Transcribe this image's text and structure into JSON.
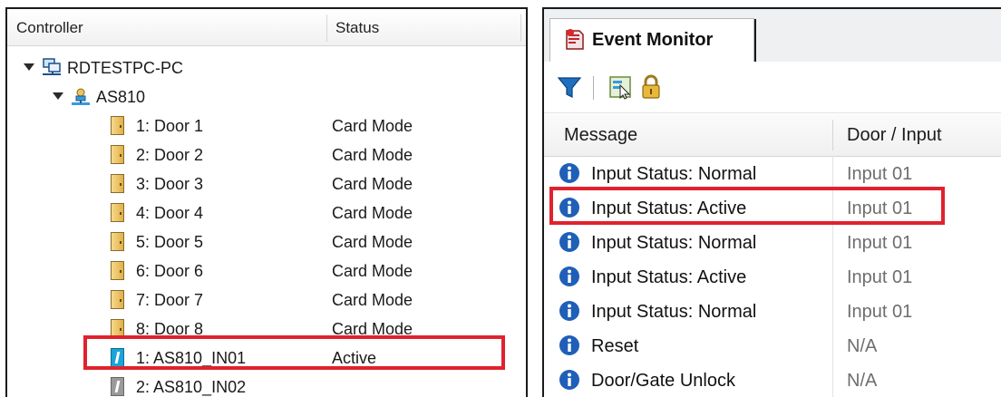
{
  "controller_panel": {
    "header": {
      "controller_col": "Controller",
      "status_col": "Status"
    },
    "pc": {
      "label": "RDTESTPC-PC"
    },
    "controller": {
      "label": "AS810"
    },
    "doors": [
      {
        "label": "1: Door 1",
        "status": "Card Mode"
      },
      {
        "label": "2: Door 2",
        "status": "Card Mode"
      },
      {
        "label": "3: Door 3",
        "status": "Card Mode"
      },
      {
        "label": "4: Door 4",
        "status": "Card Mode"
      },
      {
        "label": "5: Door 5",
        "status": "Card Mode"
      },
      {
        "label": "6: Door 6",
        "status": "Card Mode"
      },
      {
        "label": "7: Door 7",
        "status": "Card Mode"
      },
      {
        "label": "8: Door 8",
        "status": "Card Mode"
      }
    ],
    "inputs": [
      {
        "label": "1: AS810_IN01",
        "status": "Active",
        "icon": "input-active-icon"
      },
      {
        "label": "2: AS810_IN02",
        "status": "",
        "icon": "input-inactive-icon"
      }
    ]
  },
  "event_monitor": {
    "tab_label": "Event Monitor",
    "toolbar": {
      "icons": [
        "filter-icon",
        "select-icon",
        "lock-icon"
      ]
    },
    "header": {
      "message_col": "Message",
      "door_col": "Door / Input"
    },
    "rows": [
      {
        "message": "Input Status: Normal",
        "door": "Input 01"
      },
      {
        "message": "Input Status: Active",
        "door": "Input 01"
      },
      {
        "message": "Input Status: Normal",
        "door": "Input 01"
      },
      {
        "message": "Input Status: Active",
        "door": "Input 01"
      },
      {
        "message": "Input Status: Normal",
        "door": "Input 01"
      },
      {
        "message": "Reset",
        "door": "N/A"
      },
      {
        "message": "Door/Gate Unlock",
        "door": "N/A"
      }
    ]
  },
  "colors": {
    "highlight": "#e0222e",
    "input_active": "#1aa4d8",
    "door_icon": "#e0b04a"
  }
}
